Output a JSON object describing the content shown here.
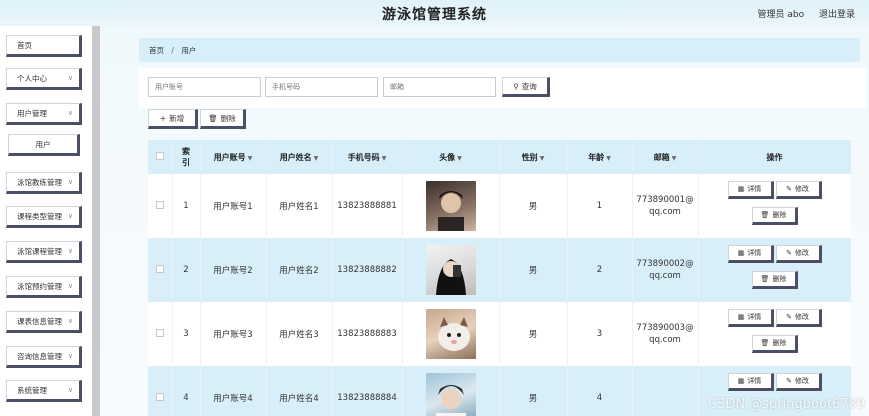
{
  "header": {
    "title": "游泳馆管理系统",
    "user_label": "管理员 abo",
    "logout_label": "退出登录"
  },
  "sidebar": {
    "items": [
      {
        "label": "首页",
        "has_chevron": false
      },
      {
        "label": "个人中心",
        "has_chevron": true
      },
      {
        "label": "用户管理",
        "has_chevron": true
      },
      {
        "label": "用户",
        "has_chevron": false,
        "sub": true
      },
      {
        "label": "泳馆教练管理",
        "has_chevron": true
      },
      {
        "label": "课程类型管理",
        "has_chevron": true
      },
      {
        "label": "泳馆课程管理",
        "has_chevron": true
      },
      {
        "label": "泳馆预约管理",
        "has_chevron": true
      },
      {
        "label": "课表信息管理",
        "has_chevron": true
      },
      {
        "label": "咨询信息管理",
        "has_chevron": true
      },
      {
        "label": "系统管理",
        "has_chevron": true
      }
    ]
  },
  "breadcrumb": {
    "home": "首页",
    "sep": "/",
    "current": "用户"
  },
  "search": {
    "account_placeholder": "用户账号",
    "phone_placeholder": "手机号码",
    "email_placeholder": "邮箱",
    "query_label": "查询"
  },
  "actions": {
    "add_label": "新增",
    "delete_label": "删除"
  },
  "table": {
    "headers": {
      "index": "索引",
      "account": "用户账号",
      "name": "用户姓名",
      "phone": "手机号码",
      "avatar": "头像",
      "gender": "性别",
      "age": "年龄",
      "email": "邮箱",
      "ops": "操作"
    },
    "rows": [
      {
        "index": "1",
        "account": "用户账号1",
        "name": "用户姓名1",
        "phone": "13823888881",
        "gender": "男",
        "age": "1",
        "email_line1": "773890001@",
        "email_line2": "qq.com"
      },
      {
        "index": "2",
        "account": "用户账号2",
        "name": "用户姓名2",
        "phone": "13823888882",
        "gender": "男",
        "age": "2",
        "email_line1": "773890002@",
        "email_line2": "qq.com"
      },
      {
        "index": "3",
        "account": "用户账号3",
        "name": "用户姓名3",
        "phone": "13823888883",
        "gender": "男",
        "age": "3",
        "email_line1": "773890003@",
        "email_line2": "qq.com"
      },
      {
        "index": "4",
        "account": "用户账号4",
        "name": "用户姓名4",
        "phone": "13823888884",
        "gender": "男",
        "age": "4",
        "email_line1": "",
        "email_line2": ""
      }
    ],
    "op_labels": {
      "detail": "详情",
      "edit": "修改",
      "delete": "删除"
    }
  },
  "watermark": "CSDN @springboot6789",
  "colors": {
    "header_bg": "#d8eff9",
    "row_alt": "#d8eff9",
    "button_shadow": "#4a4f66"
  }
}
